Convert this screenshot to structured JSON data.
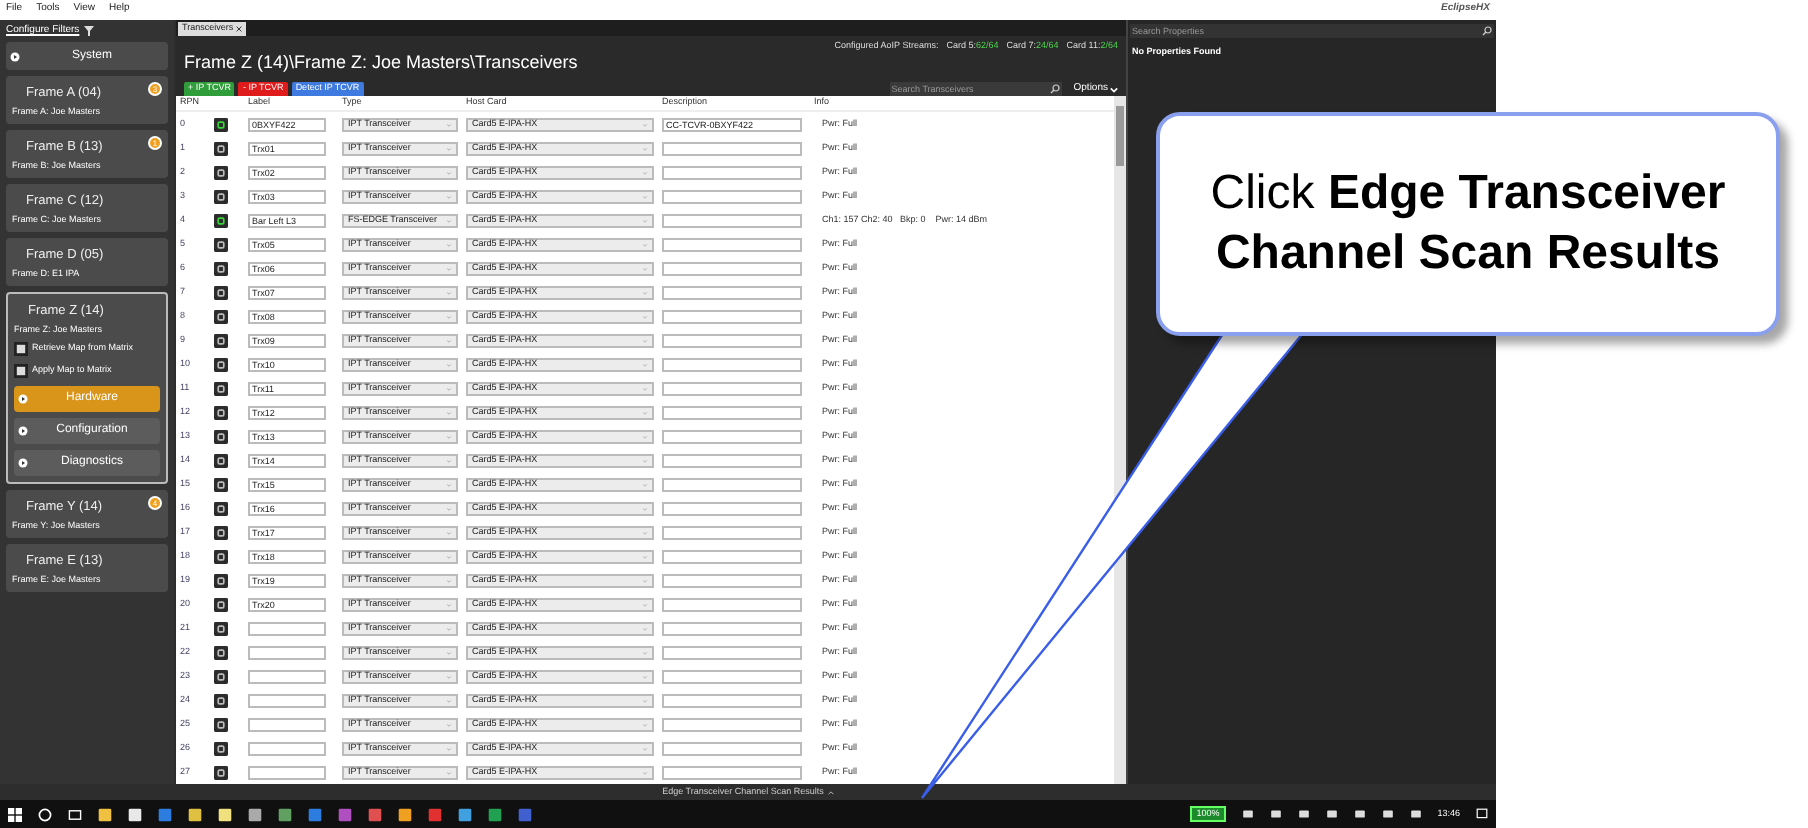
{
  "menu": [
    "File",
    "Tools",
    "View",
    "Help"
  ],
  "logo": "EclipseHX",
  "sidebar": {
    "header": "Configure Filters",
    "items": [
      {
        "kind": "section",
        "label": "System"
      },
      {
        "kind": "frame",
        "title": "Frame A (04)",
        "subtitle": "Frame A: Joe Masters",
        "badge": "3",
        "expanded": false
      },
      {
        "kind": "frame",
        "title": "Frame B (13)",
        "subtitle": "Frame B: Joe Masters",
        "badge": "1",
        "expanded": false
      },
      {
        "kind": "frame",
        "title": "Frame C (12)",
        "subtitle": "Frame C: Joe Masters",
        "expanded": false
      },
      {
        "kind": "frame",
        "title": "Frame D (05)",
        "subtitle": "Frame D: E1 IPA",
        "expanded": false
      },
      {
        "kind": "frame",
        "title": "Frame Z (14)",
        "subtitle": "Frame Z: Joe Masters",
        "expanded": true,
        "actions": [
          "Retrieve Map from Matrix",
          "Apply Map to Matrix"
        ],
        "pages": [
          {
            "label": "Hardware",
            "selected": true
          },
          {
            "label": "Configuration",
            "selected": false
          },
          {
            "label": "Diagnostics",
            "selected": false
          }
        ]
      },
      {
        "kind": "frame",
        "title": "Frame Y (14)",
        "subtitle": "Frame Y: Joe Masters",
        "badge": "4",
        "expanded": false
      },
      {
        "kind": "frame",
        "title": "Frame E (13)",
        "subtitle": "Frame E: Joe Masters",
        "expanded": false
      }
    ]
  },
  "tab": "Transceivers",
  "title": "Frame Z (14)\\Frame Z: Joe Masters\\Transceivers",
  "streams": {
    "label": "Configured AoIP Streams:",
    "cards": [
      {
        "name": "Card 5:",
        "value": "62/64"
      },
      {
        "name": "Card 7:",
        "value": "24/64"
      },
      {
        "name": "Card 11:",
        "value": "2/64"
      }
    ]
  },
  "buttons": [
    {
      "kind": "add",
      "label": "+ IP TCVR"
    },
    {
      "kind": "remove",
      "label": "- IP TCVR"
    },
    {
      "kind": "detect",
      "label": "Detect IP TCVR"
    }
  ],
  "search": {
    "placeholder": "Search Transceivers"
  },
  "options": "Options",
  "columns": [
    "RPN",
    "Label",
    "Type",
    "Host Card",
    "Description",
    "Info"
  ],
  "rows": [
    {
      "rpn": "0",
      "active": true,
      "label": "0BXYF422",
      "type": "IPT Transceiver",
      "host_card": "Card5 E-IPA-HX",
      "description": "CC-TCVR-0BXYF422",
      "info": "Pwr: Full"
    },
    {
      "rpn": "1",
      "active": false,
      "label": "Trx01",
      "type": "IPT Transceiver",
      "host_card": "Card5 E-IPA-HX",
      "info": "Pwr: Full"
    },
    {
      "rpn": "2",
      "active": false,
      "label": "Trx02",
      "type": "IPT Transceiver",
      "host_card": "Card5 E-IPA-HX",
      "info": "Pwr: Full"
    },
    {
      "rpn": "3",
      "active": false,
      "label": "Trx03",
      "type": "IPT Transceiver",
      "host_card": "Card5 E-IPA-HX",
      "info": "Pwr: Full"
    },
    {
      "rpn": "4",
      "active": true,
      "label": "Bar Left L3",
      "type": "FS-EDGE Transceiver",
      "host_card": "Card5 E-IPA-HX",
      "info": "Ch1: 157 Ch2: 40   Bkp: 0    Pwr: 14 dBm"
    },
    {
      "rpn": "5",
      "active": false,
      "label": "Trx05",
      "type": "IPT Transceiver",
      "host_card": "Card5 E-IPA-HX",
      "info": "Pwr: Full"
    },
    {
      "rpn": "6",
      "active": false,
      "label": "Trx06",
      "type": "IPT Transceiver",
      "host_card": "Card5 E-IPA-HX",
      "info": "Pwr: Full"
    },
    {
      "rpn": "7",
      "active": false,
      "label": "Trx07",
      "type": "IPT Transceiver",
      "host_card": "Card5 E-IPA-HX",
      "info": "Pwr: Full"
    },
    {
      "rpn": "8",
      "active": false,
      "label": "Trx08",
      "type": "IPT Transceiver",
      "host_card": "Card5 E-IPA-HX",
      "info": "Pwr: Full"
    },
    {
      "rpn": "9",
      "active": false,
      "label": "Trx09",
      "type": "IPT Transceiver",
      "host_card": "Card5 E-IPA-HX",
      "info": "Pwr: Full"
    },
    {
      "rpn": "10",
      "active": false,
      "label": "Trx10",
      "type": "IPT Transceiver",
      "host_card": "Card5 E-IPA-HX",
      "info": "Pwr: Full"
    },
    {
      "rpn": "11",
      "active": false,
      "label": "Trx11",
      "type": "IPT Transceiver",
      "host_card": "Card5 E-IPA-HX",
      "info": "Pwr: Full"
    },
    {
      "rpn": "12",
      "active": false,
      "label": "Trx12",
      "type": "IPT Transceiver",
      "host_card": "Card5 E-IPA-HX",
      "info": "Pwr: Full"
    },
    {
      "rpn": "13",
      "active": false,
      "label": "Trx13",
      "type": "IPT Transceiver",
      "host_card": "Card5 E-IPA-HX",
      "info": "Pwr: Full"
    },
    {
      "rpn": "14",
      "active": false,
      "label": "Trx14",
      "type": "IPT Transceiver",
      "host_card": "Card5 E-IPA-HX",
      "info": "Pwr: Full"
    },
    {
      "rpn": "15",
      "active": false,
      "label": "Trx15",
      "type": "IPT Transceiver",
      "host_card": "Card5 E-IPA-HX",
      "info": "Pwr: Full"
    },
    {
      "rpn": "16",
      "active": false,
      "label": "Trx16",
      "type": "IPT Transceiver",
      "host_card": "Card5 E-IPA-HX",
      "info": "Pwr: Full"
    },
    {
      "rpn": "17",
      "active": false,
      "label": "Trx17",
      "type": "IPT Transceiver",
      "host_card": "Card5 E-IPA-HX",
      "info": "Pwr: Full"
    },
    {
      "rpn": "18",
      "active": false,
      "label": "Trx18",
      "type": "IPT Transceiver",
      "host_card": "Card5 E-IPA-HX",
      "info": "Pwr: Full"
    },
    {
      "rpn": "19",
      "active": false,
      "label": "Trx19",
      "type": "IPT Transceiver",
      "host_card": "Card5 E-IPA-HX",
      "info": "Pwr: Full"
    },
    {
      "rpn": "20",
      "active": false,
      "label": "Trx20",
      "type": "IPT Transceiver",
      "host_card": "Card5 E-IPA-HX",
      "info": "Pwr: Full"
    },
    {
      "rpn": "21",
      "active": false,
      "type": "IPT Transceiver",
      "host_card": "Card5 E-IPA-HX",
      "info": "Pwr: Full"
    },
    {
      "rpn": "22",
      "active": false,
      "type": "IPT Transceiver",
      "host_card": "Card5 E-IPA-HX",
      "info": "Pwr: Full"
    },
    {
      "rpn": "23",
      "active": false,
      "type": "IPT Transceiver",
      "host_card": "Card5 E-IPA-HX",
      "info": "Pwr: Full"
    },
    {
      "rpn": "24",
      "active": false,
      "type": "IPT Transceiver",
      "host_card": "Card5 E-IPA-HX",
      "info": "Pwr: Full"
    },
    {
      "rpn": "25",
      "active": false,
      "type": "IPT Transceiver",
      "host_card": "Card5 E-IPA-HX",
      "info": "Pwr: Full"
    },
    {
      "rpn": "26",
      "active": false,
      "type": "IPT Transceiver",
      "host_card": "Card5 E-IPA-HX",
      "info": "Pwr: Full"
    },
    {
      "rpn": "27",
      "active": false,
      "type": "IPT Transceiver",
      "host_card": "Card5 E-IPA-HX",
      "info": "Pwr: Full"
    }
  ],
  "properties": {
    "placeholder": "Search Properties",
    "message": "No Properties Found"
  },
  "status_bar": "Edge Transceiver Channel Scan Results",
  "taskbar": {
    "battery": "100%",
    "time": "13:46"
  },
  "callout": "Click **Edge Transceiver Channel Scan Results**"
}
